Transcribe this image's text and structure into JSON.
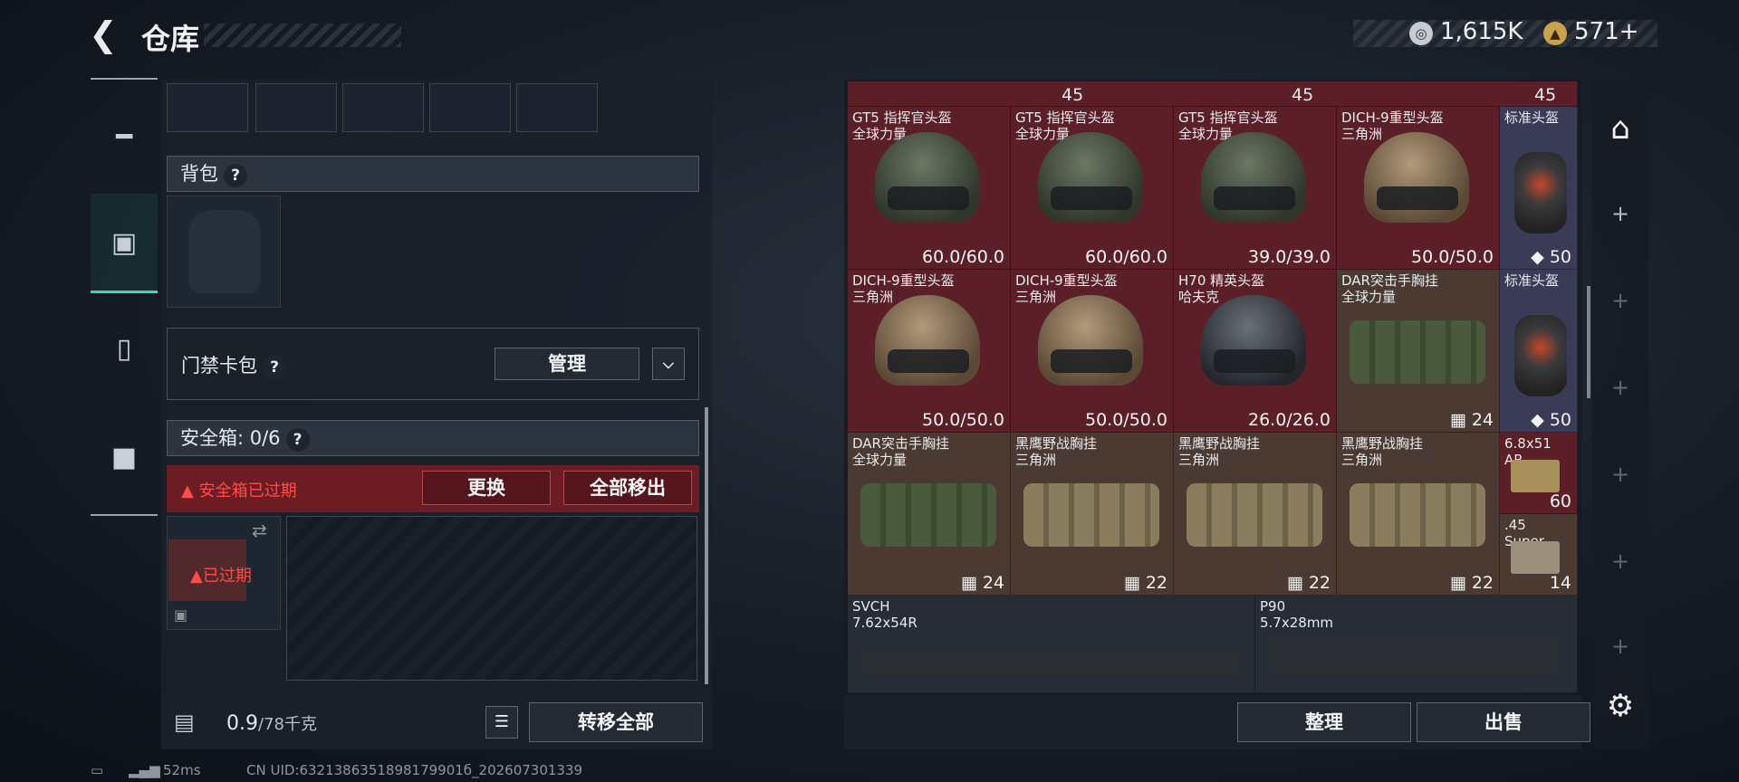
{
  "header": {
    "title": "仓库"
  },
  "currency": [
    {
      "icon": "silver-coin-icon",
      "value": "1,615K"
    },
    {
      "icon": "gold-coin-icon",
      "value": "571+"
    }
  ],
  "nav": [
    {
      "icon": "pistol-icon"
    },
    {
      "icon": "backpack-gear-icon"
    },
    {
      "icon": "clipboard-icon"
    },
    {
      "icon": "briefcase-icon"
    }
  ],
  "left": {
    "backpack_label": "背包",
    "keycard_label": "门禁卡包",
    "manage_label": "管理",
    "safebox_label": "安全箱: 0/6",
    "warning": "安全箱已过期",
    "replace_label": "更换",
    "move_all_label": "全部移出",
    "expired_label": "已过期",
    "weight_value": "0.9",
    "weight_max": "/78千克",
    "transfer_label": "转移全部"
  },
  "right": {
    "prev_counts": [
      "45",
      "45",
      "45"
    ],
    "items": [
      {
        "name": "GT5 指挥官头盔\n全球力量",
        "value": "60.0/60.0"
      },
      {
        "name": "GT5 指挥官头盔\n全球力量",
        "value": "60.0/60.0"
      },
      {
        "name": "GT5 指挥官头盔\n全球力量",
        "value": "39.0/39.0"
      },
      {
        "name": "DICH-9重型头盔\n三角洲",
        "value": "50.0/50.0"
      },
      {
        "name": "标准头盔",
        "value": "50"
      },
      {
        "name": "DICH-9重型头盔\n三角洲",
        "value": "50.0/50.0"
      },
      {
        "name": "DICH-9重型头盔\n三角洲",
        "value": "50.0/50.0"
      },
      {
        "name": "H70 精英头盔\n哈夫克",
        "value": "26.0/26.0"
      },
      {
        "name": "DAR突击手胸挂\n全球力量",
        "value": "24"
      },
      {
        "name": "标准头盔",
        "value": "50"
      },
      {
        "name": "DAR突击手胸挂\n全球力量",
        "value": "24"
      },
      {
        "name": "黑鹰野战胸挂\n三角洲",
        "value": "22"
      },
      {
        "name": "黑鹰野战胸挂\n三角洲",
        "value": "22"
      },
      {
        "name": "黑鹰野战胸挂\n三角洲",
        "value": "22"
      },
      {
        "name": "6.8x51\nAP",
        "value": "60"
      },
      {
        "name": ".45\nSuper",
        "value": "14"
      },
      {
        "name": "SVCH\n7.62x54R",
        "value": ""
      },
      {
        "name": "P90\n5.7x28mm",
        "value": ""
      }
    ],
    "sort_label": "整理",
    "sell_label": "出售"
  },
  "status": {
    "ping": "52ms",
    "uid": "CN UID:6321386351898179901б_202607301339"
  }
}
